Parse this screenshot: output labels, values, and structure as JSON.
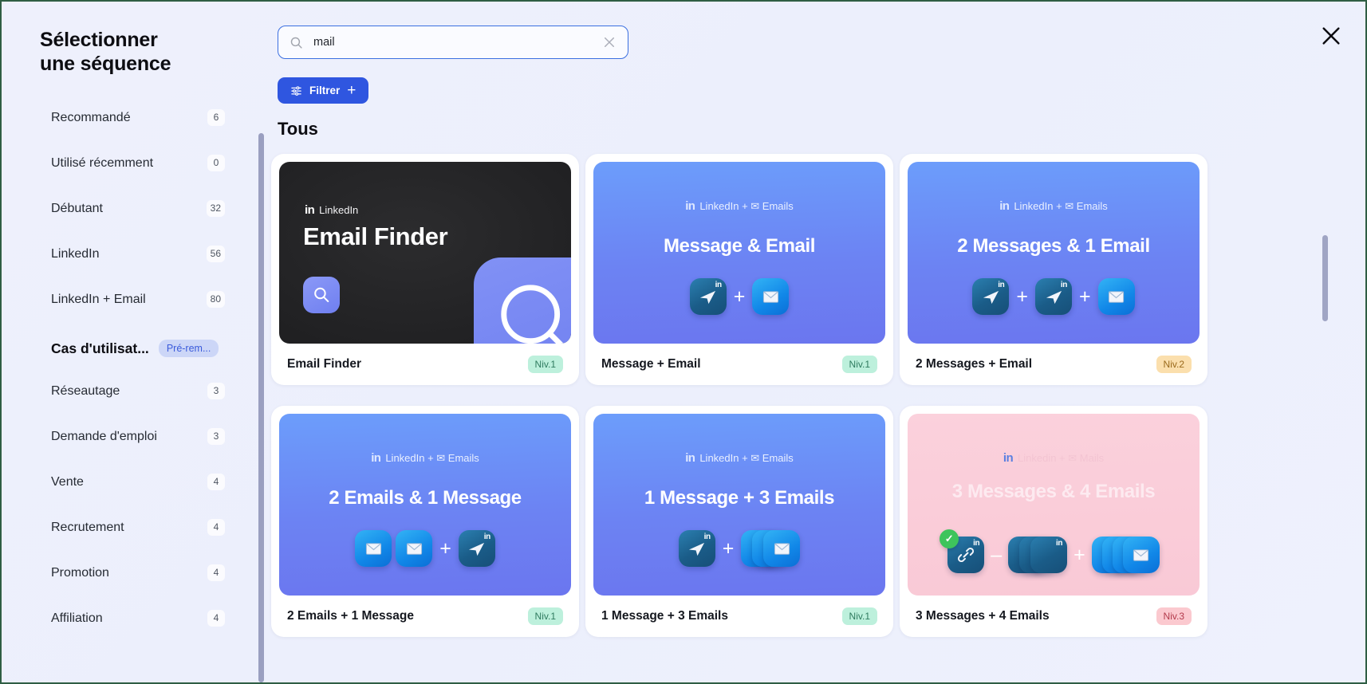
{
  "panel": {
    "title": "Sélectionner une séquence",
    "close_icon": "close-icon"
  },
  "search": {
    "icon": "search-icon",
    "value": "mail",
    "placeholder": "",
    "clear_icon": "close-icon"
  },
  "filter": {
    "label": "Filtrer",
    "icon": "sliders-icon",
    "plus": "+"
  },
  "sidebar": {
    "items": [
      {
        "label": "Recommandé",
        "count": "6"
      },
      {
        "label": "Utilisé récemment",
        "count": "0"
      },
      {
        "label": "Débutant",
        "count": "32"
      },
      {
        "label": "LinkedIn",
        "count": "56"
      },
      {
        "label": "LinkedIn + Email",
        "count": "80"
      }
    ],
    "section": {
      "title": "Cas d'utilisat...",
      "badge": "Pré-rem..."
    },
    "use_cases": [
      {
        "label": "Réseautage",
        "count": "3"
      },
      {
        "label": "Demande d'emploi",
        "count": "3"
      },
      {
        "label": "Vente",
        "count": "4"
      },
      {
        "label": "Recrutement",
        "count": "4"
      },
      {
        "label": "Promotion",
        "count": "4"
      },
      {
        "label": "Affiliation",
        "count": "4"
      }
    ]
  },
  "main": {
    "section_title": "Tous",
    "cards": [
      {
        "theme": "dark",
        "brand_in": "in",
        "brand_text": "LinkedIn",
        "thumb_title": "Email Finder",
        "name": "Email Finder",
        "level": "Niv.1",
        "level_class": "lvl-1"
      },
      {
        "theme": "blue",
        "brand_in": "in",
        "brand_text": "LinkedIn + ✉ Emails",
        "thumb_title": "Message & Email",
        "name": "Message + Email",
        "level": "Niv.1",
        "level_class": "lvl-1"
      },
      {
        "theme": "blue",
        "brand_in": "in",
        "brand_text": "LinkedIn + ✉ Emails",
        "thumb_title": "2 Messages & 1 Email",
        "name": "2 Messages + Email",
        "level": "Niv.2",
        "level_class": "lvl-2"
      },
      {
        "theme": "blue",
        "brand_in": "in",
        "brand_text": "LinkedIn + ✉ Emails",
        "thumb_title": "2 Emails & 1 Message",
        "name": "2 Emails + 1 Message",
        "level": "Niv.1",
        "level_class": "lvl-1"
      },
      {
        "theme": "blue",
        "brand_in": "in",
        "brand_text": "LinkedIn + ✉ Emails",
        "thumb_title": "1 Message + 3 Emails",
        "name": "1 Message + 3 Emails",
        "level": "Niv.1",
        "level_class": "lvl-1"
      },
      {
        "theme": "pink",
        "brand_in": "in",
        "brand_text": "Linkedin + ✉ Mails",
        "thumb_title": "3 Messages & 4 Emails",
        "name": "3 Messages + 4 Emails",
        "level": "Niv.3",
        "level_class": "lvl-3"
      }
    ]
  },
  "colors": {
    "accent": "#2f56e0",
    "background": "#eef0fb",
    "level1": "#bdf0dc",
    "level2": "#fbdfad",
    "level3": "#fbc9cf"
  }
}
